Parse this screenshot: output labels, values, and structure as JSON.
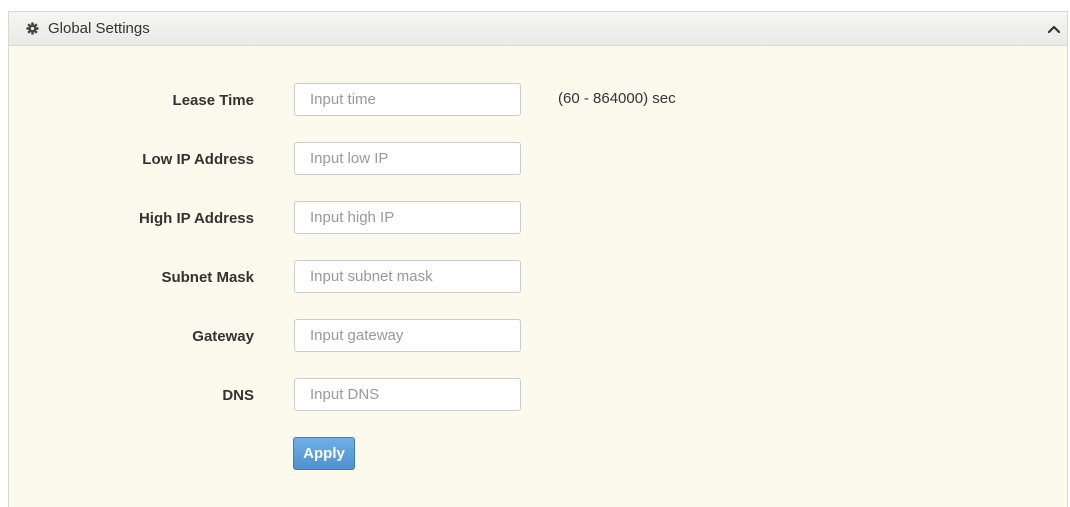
{
  "panel": {
    "title": "Global Settings",
    "icon": "gear-icon",
    "collapse_icon": "chevron-up-icon"
  },
  "form": {
    "fields": [
      {
        "label": "Lease Time",
        "placeholder": "Input time",
        "value": ""
      },
      {
        "label": "Low IP Address",
        "placeholder": "Input low IP",
        "value": ""
      },
      {
        "label": "High IP Address",
        "placeholder": "Input high IP",
        "value": ""
      },
      {
        "label": "Subnet Mask",
        "placeholder": "Input subnet mask",
        "value": ""
      },
      {
        "label": "Gateway",
        "placeholder": "Input gateway",
        "value": ""
      },
      {
        "label": "DNS",
        "placeholder": "Input DNS",
        "value": ""
      }
    ],
    "lease_hint": "(60 - 864000) sec",
    "apply_label": "Apply"
  },
  "colors": {
    "panel_background": "#fbfaed",
    "button_primary": "#5b9bd5"
  }
}
